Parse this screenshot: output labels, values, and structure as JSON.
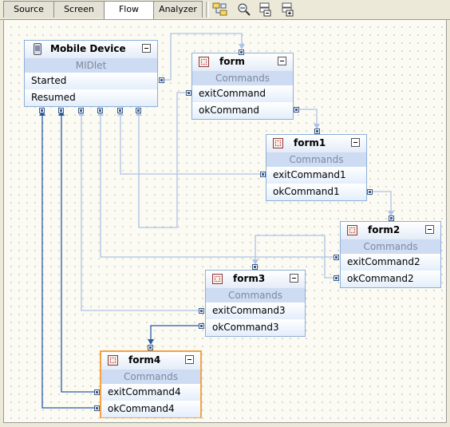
{
  "tabs": [
    {
      "label": "Source",
      "active": false
    },
    {
      "label": "Screen",
      "active": false
    },
    {
      "label": "Flow",
      "active": true
    },
    {
      "label": "Analyzer",
      "active": false
    }
  ],
  "toolbar": [
    "layout-icon",
    "zoom-icon",
    "collapse-all-icon",
    "expand-all-icon"
  ],
  "nodes": {
    "mobile": {
      "title": "Mobile Device",
      "subtitle": "MIDlet",
      "rows": [
        "Started",
        "Resumed"
      ]
    },
    "form": {
      "title": "form",
      "subtitle": "Commands",
      "rows": [
        "exitCommand",
        "okCommand"
      ]
    },
    "form1": {
      "title": "form1",
      "subtitle": "Commands",
      "rows": [
        "exitCommand1",
        "okCommand1"
      ]
    },
    "form2": {
      "title": "form2",
      "subtitle": "Commands",
      "rows": [
        "exitCommand2",
        "okCommand2"
      ]
    },
    "form3": {
      "title": "form3",
      "subtitle": "Commands",
      "rows": [
        "exitCommand3",
        "okCommand3"
      ]
    },
    "form4": {
      "title": "form4",
      "subtitle": "Commands",
      "rows": [
        "exitCommand4",
        "okCommand4"
      ]
    }
  },
  "colors": {
    "wire": "#adc4e6",
    "wire_selected": "#2a5aa6",
    "selection_border": "#f5a142",
    "header_band": "#cddbf3"
  }
}
